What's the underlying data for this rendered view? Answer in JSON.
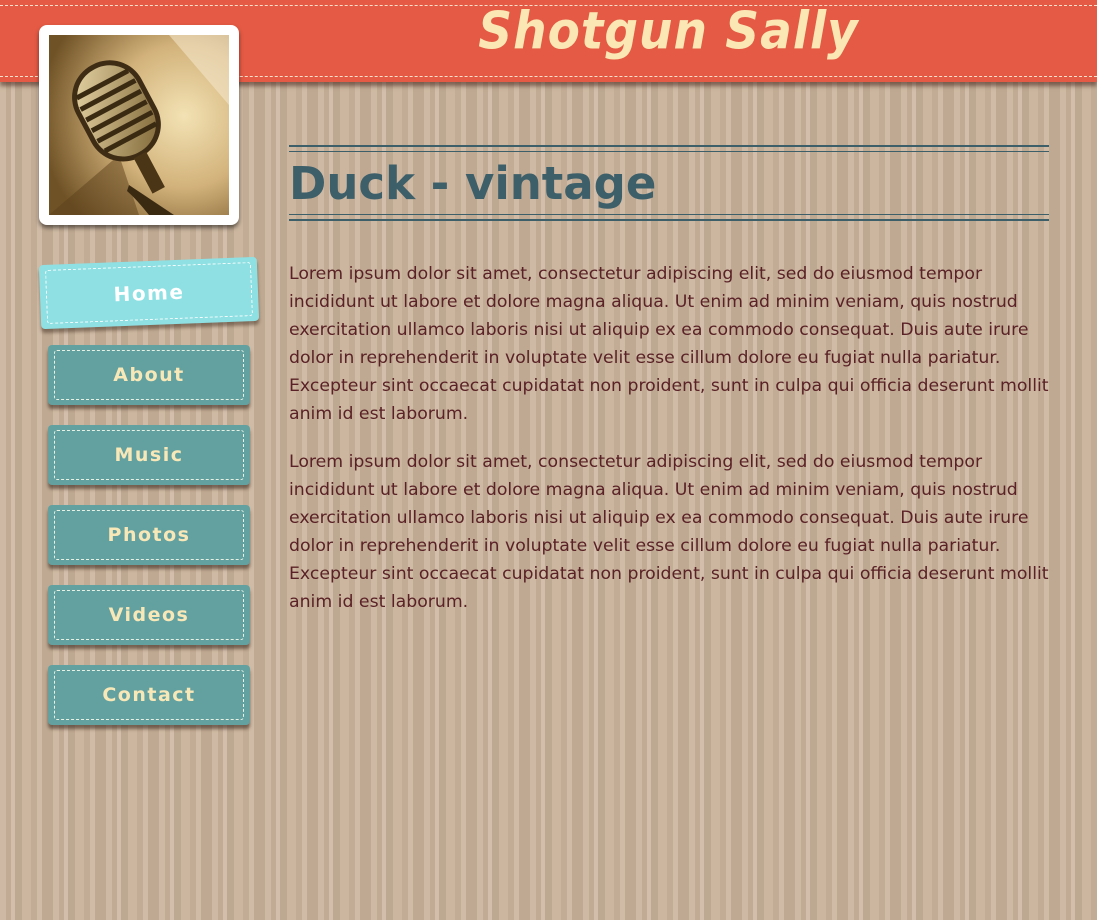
{
  "site": {
    "title": "Shotgun Sally"
  },
  "avatar": {
    "icon": "microphone-photo"
  },
  "nav": {
    "items": [
      {
        "label": "Home",
        "active": true
      },
      {
        "label": "About",
        "active": false
      },
      {
        "label": "Music",
        "active": false
      },
      {
        "label": "Photos",
        "active": false
      },
      {
        "label": "Videos",
        "active": false
      },
      {
        "label": "Contact",
        "active": false
      }
    ]
  },
  "main": {
    "title": "Duck - vintage",
    "paragraphs": [
      "Lorem ipsum dolor sit amet, consectetur adipiscing elit, sed do eiusmod tempor incididunt ut labore et dolore magna aliqua. Ut enim ad minim veniam, quis nostrud exercitation ullamco laboris nisi ut aliquip ex ea commodo consequat. Duis aute irure dolor in reprehenderit in voluptate velit esse cillum dolore eu fugiat nulla pariatur. Excepteur sint occaecat cupidatat non proident, sunt in culpa qui officia deserunt mollit anim id est laborum.",
      "Lorem ipsum dolor sit amet, consectetur adipiscing elit, sed do eiusmod tempor incididunt ut labore et dolore magna aliqua. Ut enim ad minim veniam, quis nostrud exercitation ullamco laboris nisi ut aliquip ex ea commodo consequat. Duis aute irure dolor in reprehenderit in voluptate velit esse cillum dolore eu fugiat nulla pariatur. Excepteur sint occaecat cupidatat non proident, sunt in culpa qui officia deserunt mollit anim id est laborum."
    ]
  },
  "colors": {
    "header": "#e45a44",
    "title_text": "#fbe7b4",
    "nav_button": "#62a1a0",
    "nav_active": "#8ee0e3",
    "heading": "#3d5f6a",
    "body_text": "#5a2226",
    "background": "#c9b29a"
  }
}
